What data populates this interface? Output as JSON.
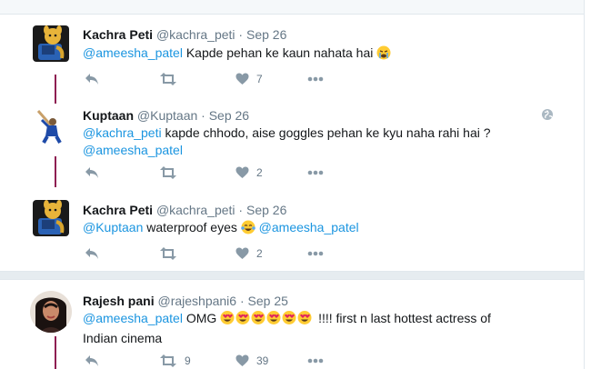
{
  "tweets": [
    {
      "name": "Kachra Peti",
      "handle": "@kachra_peti",
      "separator": "·",
      "time": "Sep 26",
      "mention": "@ameesha_patel",
      "text": " Kapde pehan ke kaun nahata hai ",
      "likes": "7",
      "retweets": ""
    },
    {
      "name": "Kuptaan",
      "handle": "@Kuptaan",
      "separator": "·",
      "time": "Sep 26",
      "mention": "@kachra_peti",
      "text": " kapde chhodo, aise goggles pehan ke kyu naha rahi hai ?",
      "mention2": "@ameesha_patel",
      "likes": "2",
      "retweets": ""
    },
    {
      "name": "Kachra Peti",
      "handle": "@kachra_peti",
      "separator": "·",
      "time": "Sep 26",
      "mention": "@Kuptaan",
      "text": " waterproof eyes ",
      "mention2": "@ameesha_patel",
      "likes": "2",
      "retweets": ""
    },
    {
      "name": "Rajesh pani",
      "handle": "@rajeshpani6",
      "separator": "·",
      "time": "Sep 25",
      "mention": "@ameesha_patel",
      "text": "  OMG ",
      "text2": " !!!! first n last  hottest actress of",
      "text3": "Indian cinema",
      "retweets": "9",
      "likes": "39"
    }
  ],
  "icons": {
    "reply": "reply-icon",
    "retweet": "retweet-icon",
    "like": "heart-icon",
    "more": "more-icon",
    "globe": "globe-icon"
  },
  "colors": {
    "mention": "#1b95e0",
    "thread_line": "#8e1f52",
    "action_icon": "#8899a6"
  }
}
